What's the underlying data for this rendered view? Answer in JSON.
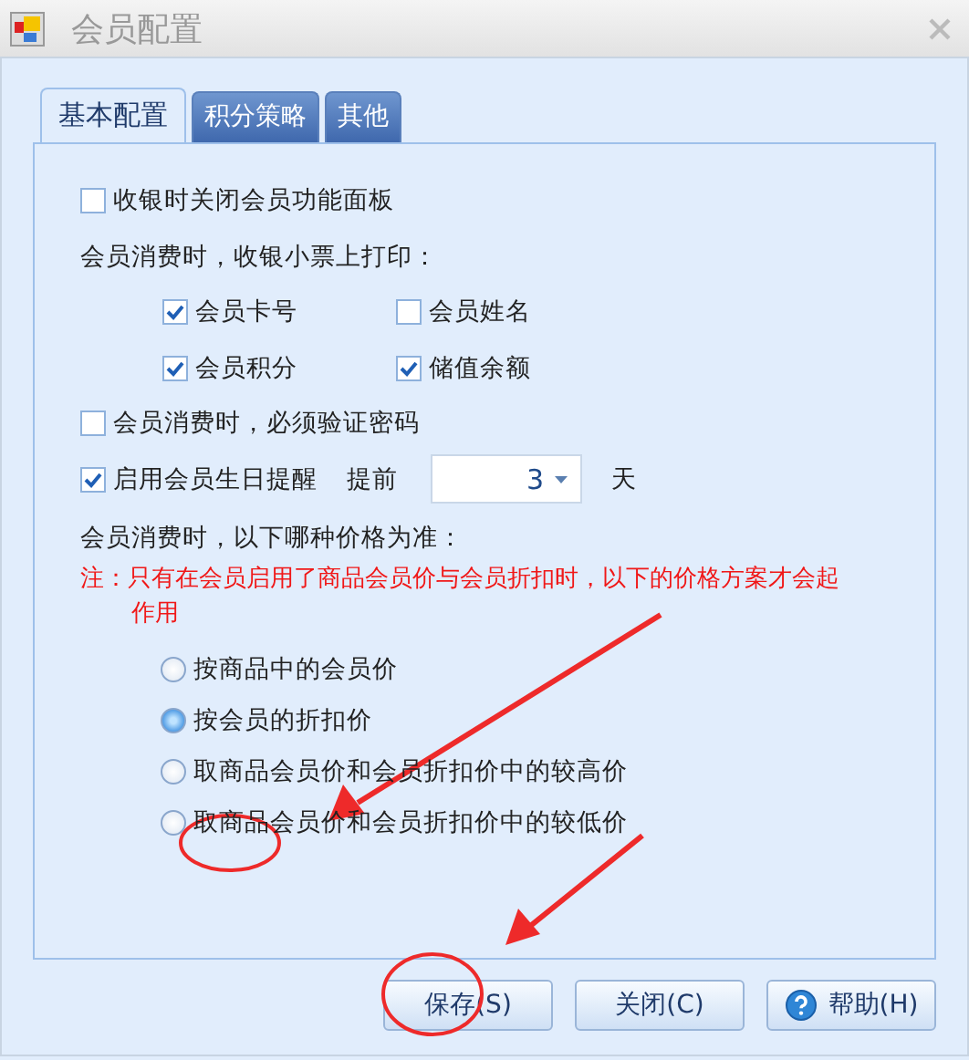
{
  "window": {
    "title": "会员配置"
  },
  "tabs": [
    {
      "label": "基本配置",
      "selected": true
    },
    {
      "label": "积分策略",
      "selected": false
    },
    {
      "label": "其他",
      "selected": false
    }
  ],
  "close_panel": {
    "label": "收银时关闭会员功能面板",
    "checked": false
  },
  "receipt": {
    "label": "会员消费时，收银小票上打印：",
    "items": [
      {
        "label": "会员卡号",
        "checked": true
      },
      {
        "label": "会员姓名",
        "checked": false
      },
      {
        "label": "会员积分",
        "checked": true
      },
      {
        "label": "储值余额",
        "checked": true
      }
    ]
  },
  "require_password": {
    "label": "会员消费时，必须验证密码",
    "checked": false
  },
  "birthday_reminder": {
    "label": "启用会员生日提醒",
    "checked": true,
    "advance_label": "提前",
    "days": "3",
    "unit": "天"
  },
  "price": {
    "label": "会员消费时，以下哪种价格为准：",
    "note": "注：只有在会员启用了商品会员价与会员折扣时，以下的价格方案才会起作用",
    "options": [
      {
        "label": "按商品中的会员价",
        "selected": false
      },
      {
        "label": "按会员的折扣价",
        "selected": true
      },
      {
        "label": "取商品会员价和会员折扣价中的较高价",
        "selected": false
      },
      {
        "label": "取商品会员价和会员折扣价中的较低价",
        "selected": false
      }
    ]
  },
  "buttons": [
    {
      "label": "保存(S)",
      "kind": "plain"
    },
    {
      "label": "关闭(C)",
      "kind": "plain"
    },
    {
      "label": "帮助(H)",
      "kind": "help"
    }
  ]
}
